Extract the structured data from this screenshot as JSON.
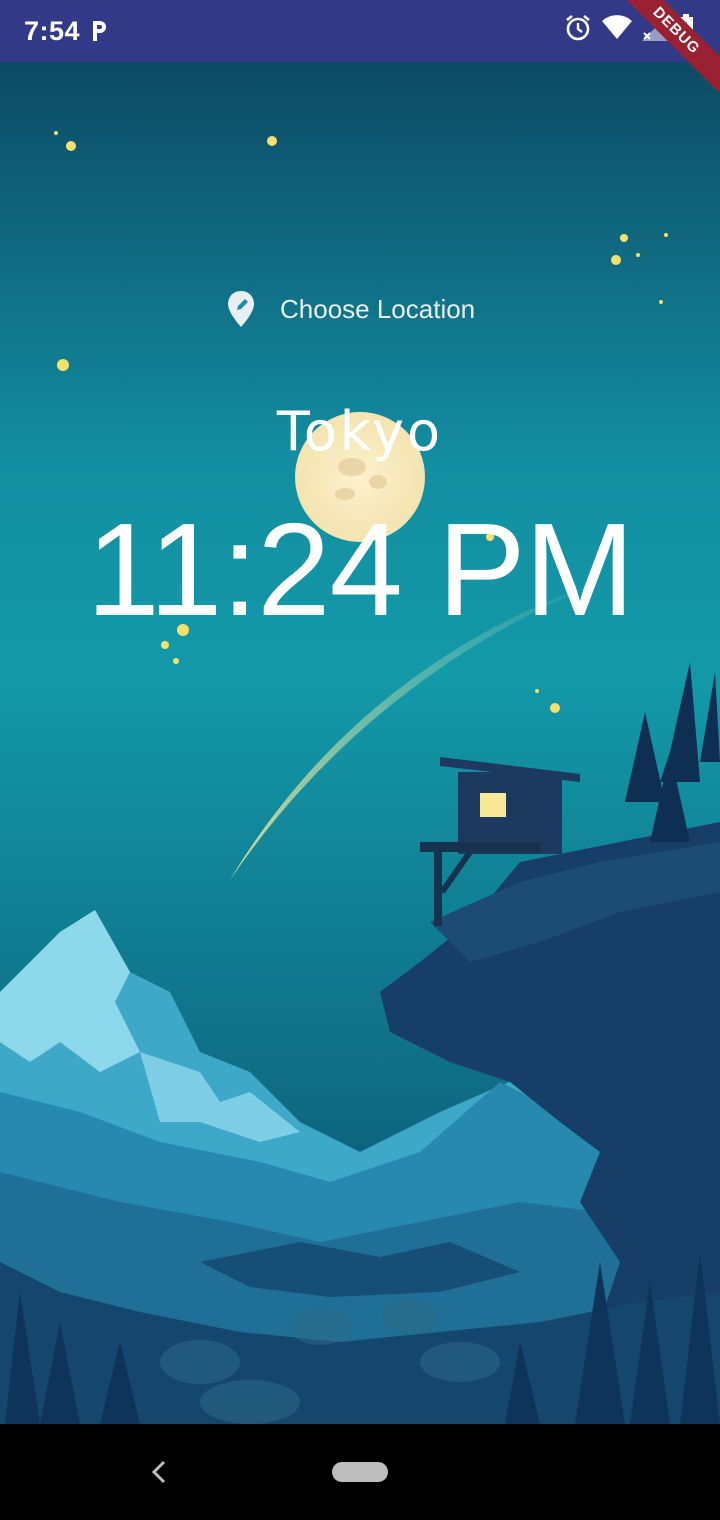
{
  "status_bar": {
    "time": "7:54",
    "icons": [
      "parking-notification-icon",
      "alarm-icon",
      "wifi-icon",
      "signal-icon",
      "battery-charging-icon"
    ]
  },
  "debug_banner": {
    "label": "DEBUG"
  },
  "location_button": {
    "label": "Choose Location",
    "icon": "location-pin-edit-icon"
  },
  "city": "Tokyo",
  "time": "11:24 PM",
  "scene": {
    "mode": "night",
    "sky_top": "#0f4a63",
    "sky_mid": "#1399a8"
  },
  "nav_bar": {
    "icons": [
      "back-icon",
      "home-pill"
    ]
  }
}
